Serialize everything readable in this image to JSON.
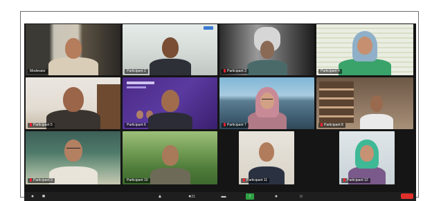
{
  "participants": [
    {
      "name": "Moderator",
      "muted": false
    },
    {
      "name": "Participant 2",
      "muted": false
    },
    {
      "name": "Participant 3",
      "muted": true
    },
    {
      "name": "Participant 4",
      "muted": false
    },
    {
      "name": "Participant 5",
      "muted": true
    },
    {
      "name": "Participant 6",
      "muted": false
    },
    {
      "name": "Participant 7",
      "muted": true
    },
    {
      "name": "Participant 8",
      "muted": true
    },
    {
      "name": "Participant 9",
      "muted": true
    },
    {
      "name": "Participant 10",
      "muted": false
    },
    {
      "name": "Participant 11",
      "muted": true
    },
    {
      "name": "Participant 12",
      "muted": true
    }
  ],
  "toolbar": {
    "mute_icon": "microphone-icon",
    "video_icon": "video-camera-icon",
    "security_icon": "shield-icon",
    "participants_icon": "people-icon",
    "participants_count": "21",
    "chat_icon": "chat-icon",
    "share_icon": "share-screen-icon",
    "record_icon": "record-icon",
    "reactions_icon": "emoji-icon",
    "end_color": "#e0302b"
  },
  "colors": {
    "active_speaker_border": "#d8d86a",
    "window_bg": "#151515"
  }
}
